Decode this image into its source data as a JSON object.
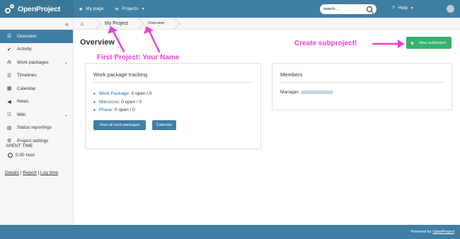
{
  "header": {
    "logo_text": "OpenProject",
    "nav": [
      {
        "icon": "home-icon",
        "label": "My page"
      },
      {
        "icon": "projects-icon",
        "label": "Projects"
      }
    ],
    "search_placeholder": "search ...",
    "help_label": "Help"
  },
  "breadcrumb": {
    "project": "My Project",
    "page": "Overview"
  },
  "sidebar": {
    "collapse_glyph": "«",
    "items": [
      {
        "icon": "overview-icon",
        "glyph": "☰",
        "label": "Overview",
        "active": true,
        "expandable": false
      },
      {
        "icon": "activity-icon",
        "glyph": "✔",
        "label": "Activity",
        "active": false,
        "expandable": false
      },
      {
        "icon": "work-packages-icon",
        "glyph": "⁂",
        "label": "Work packages",
        "active": false,
        "expandable": true
      },
      {
        "icon": "timelines-icon",
        "glyph": "☰",
        "label": "Timelines",
        "active": false,
        "expandable": false
      },
      {
        "icon": "calendar-icon",
        "glyph": "▦",
        "label": "Calendar",
        "active": false,
        "expandable": false
      },
      {
        "icon": "news-icon",
        "glyph": "◀",
        "label": "News",
        "active": false,
        "expandable": false
      },
      {
        "icon": "wiki-icon",
        "glyph": "☷",
        "label": "Wiki",
        "active": false,
        "expandable": true
      },
      {
        "icon": "status-reporting-icon",
        "glyph": "▤",
        "label": "Status reportings",
        "active": false,
        "expandable": false
      },
      {
        "icon": "project-settings-icon",
        "glyph": "⚙",
        "label": "Project settings",
        "active": false,
        "expandable": false
      }
    ],
    "spent_time_label": "SPENT TIME",
    "spent_time_value": "0.00 hour",
    "links": [
      "Details",
      "Report",
      "Log time"
    ],
    "link_separator": " | "
  },
  "main": {
    "title": "Overview",
    "new_subproject_label": "New subproject",
    "annotations": {
      "project_name": "First Project: Your Name",
      "create_subproject": "Create subproject!"
    },
    "work_package_box": {
      "title": "Work package tracking",
      "rows": [
        {
          "link": "Work Package",
          "text": ": 0 open / 0"
        },
        {
          "link": "Milestone",
          "text": ": 0 open / 0"
        },
        {
          "link": "Phase",
          "text": ": 0 open / 0"
        }
      ],
      "buttons": [
        "View all work packages",
        "Calendar"
      ]
    },
    "members_box": {
      "title": "Members",
      "manager_label": "Manager:"
    }
  },
  "footer": {
    "text": "Powered by",
    "link": "OpenProject"
  },
  "colors": {
    "header": "#3f7fa4",
    "accent_green": "#35b26b",
    "annotation_pink": "#ef3fd8",
    "link": "#2474a8"
  }
}
